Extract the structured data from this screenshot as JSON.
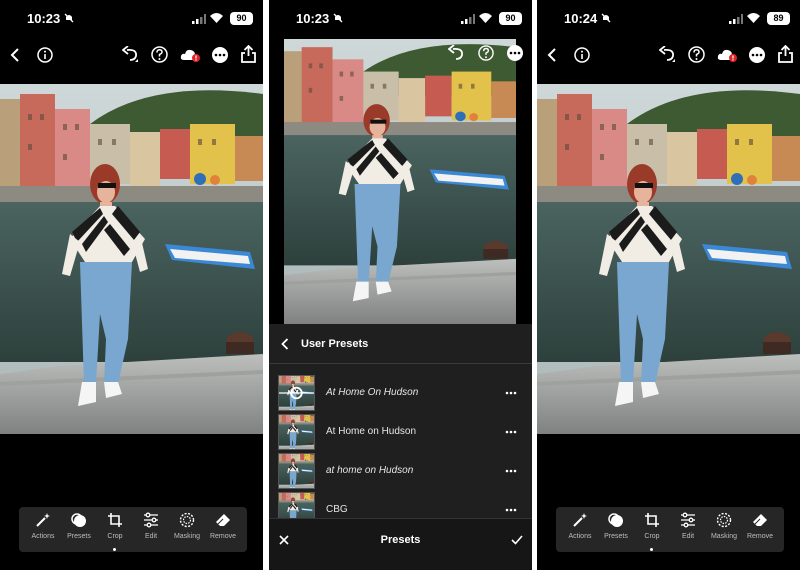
{
  "screens": [
    {
      "time": "10:23",
      "battery": "90"
    },
    {
      "time": "10:23",
      "battery": "90"
    },
    {
      "time": "10:24",
      "battery": "89"
    }
  ],
  "toolbar": {
    "items": [
      {
        "label": "Actions",
        "icon": "wand-icon"
      },
      {
        "label": "Presets",
        "icon": "presets-icon"
      },
      {
        "label": "Crop",
        "icon": "crop-icon"
      },
      {
        "label": "Edit",
        "icon": "sliders-icon"
      },
      {
        "label": "Masking",
        "icon": "masking-icon"
      },
      {
        "label": "Remove",
        "icon": "eraser-icon"
      }
    ]
  },
  "presets_panel": {
    "header_title": "User Presets",
    "items": [
      {
        "name": "At Home On Hudson"
      },
      {
        "name": "At Home on Hudson"
      },
      {
        "name": "at home on Hudson"
      },
      {
        "name": "CBG"
      }
    ],
    "footer_title": "Presets"
  },
  "colors": {
    "background": "#000000",
    "panel": "#1f1f1f",
    "sync_badge": "#e0242a"
  }
}
